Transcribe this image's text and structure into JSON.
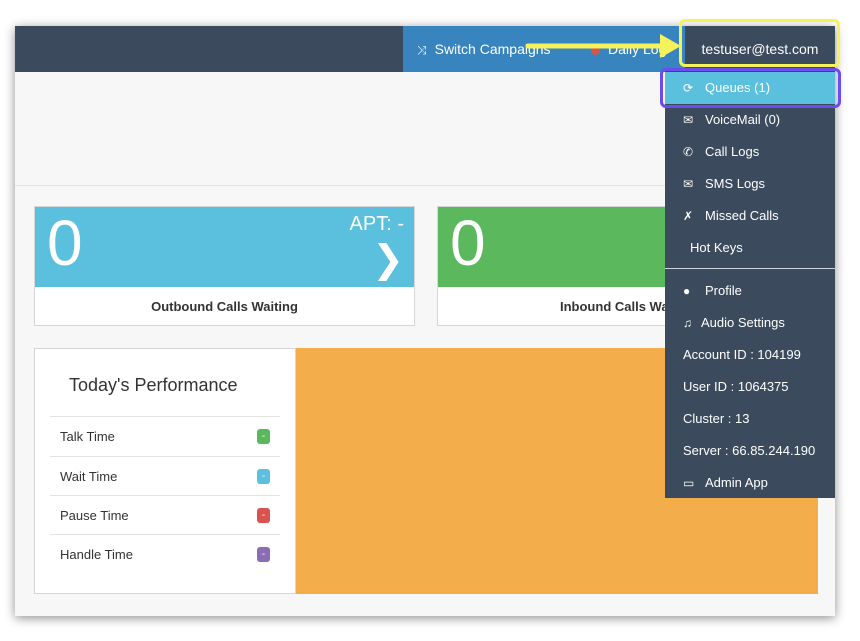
{
  "navbar": {
    "switch_campaigns": "Switch Campaigns",
    "daily_log": "Daily Log",
    "user_email": "testuser@test.com"
  },
  "stats": [
    {
      "value": "0",
      "apt": "APT: -",
      "label": "Outbound Calls Waiting",
      "color": "#5bc0de"
    },
    {
      "value": "0",
      "label": "Inbound Calls Wa",
      "color": "#5cb85c"
    }
  ],
  "performance": {
    "title": "Today's Performance",
    "rows": [
      {
        "name": "Talk Time",
        "value": "-",
        "color": "#5cb85c"
      },
      {
        "name": "Wait Time",
        "value": "-",
        "color": "#5bc0de"
      },
      {
        "name": "Pause Time",
        "value": "-",
        "color": "#d9534f"
      },
      {
        "name": "Handle Time",
        "value": "-",
        "color": "#8a6db5"
      }
    ]
  },
  "dropdown": {
    "items": [
      {
        "icon": "refresh-icon",
        "label": "Queues (1)"
      },
      {
        "icon": "envelope-icon",
        "label": "VoiceMail (0)"
      },
      {
        "icon": "phone-icon",
        "label": "Call Logs"
      },
      {
        "icon": "envelope-icon",
        "label": "SMS Logs"
      },
      {
        "icon": "missed-call-icon",
        "label": "Missed Calls"
      },
      {
        "icon": "",
        "label": "Hot Keys"
      },
      {
        "icon": "user-icon",
        "label": "Profile"
      },
      {
        "icon": "headphones-icon",
        "label": "Audio Settings"
      },
      {
        "icon": "",
        "label": "Account ID : 104199"
      },
      {
        "icon": "",
        "label": "User ID : 1064375"
      },
      {
        "icon": "",
        "label": "Cluster : 13"
      },
      {
        "icon": "",
        "label": "Server : 66.85.244.190"
      },
      {
        "icon": "monitor-icon",
        "label": "Admin App"
      }
    ]
  },
  "colors": {
    "navbar": "#3b4a5c",
    "switch_bg": "#3784bf",
    "active_item": "#5bc0de",
    "orange_panel": "#f3ae4b",
    "highlight_yellow": "#f5f25a",
    "highlight_purple": "#6a4cf0"
  }
}
